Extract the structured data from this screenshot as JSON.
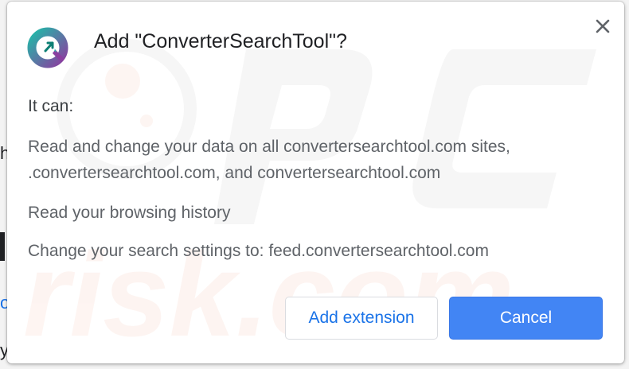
{
  "dialog": {
    "title": "Add \"ConverterSearchTool\"?",
    "it_can_label": "It can:",
    "permissions": [
      "Read and change your data on all convertersearchtool.com sites, .convertersearchtool.com, and convertersearchtool.com",
      "Read your browsing history",
      "Change your search settings to: feed.convertersearchtool.com"
    ],
    "add_button_label": "Add extension",
    "cancel_button_label": "Cancel",
    "close_icon": "close-icon",
    "extension_icon": "convertersearchtool-logo-icon"
  },
  "colors": {
    "accent": "#1a73e8",
    "primary_button": "#4285f4",
    "title_text": "#202124",
    "body_text": "#5f6368"
  }
}
